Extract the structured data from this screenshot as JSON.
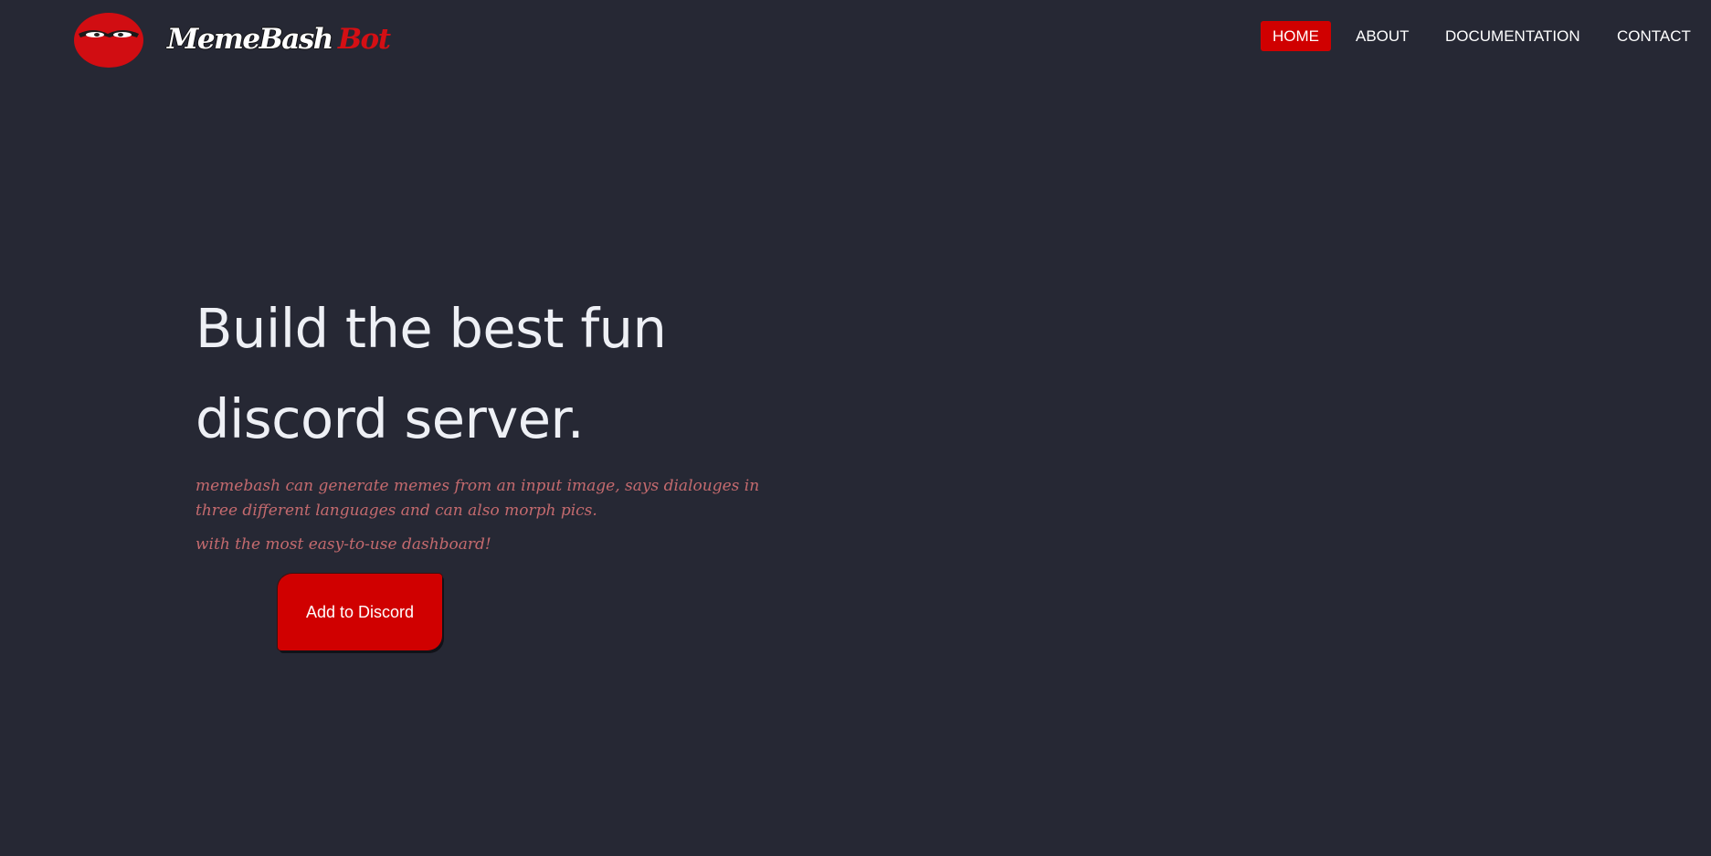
{
  "header": {
    "brand_part1": "MemeBash",
    "brand_part2": "Bot",
    "logo_icon": "masked-face-logo-icon"
  },
  "nav": {
    "items": [
      {
        "label": "HOME",
        "active": true
      },
      {
        "label": "ABOUT",
        "active": false
      },
      {
        "label": "DOCUMENTATION",
        "active": false
      },
      {
        "label": "CONTACT",
        "active": false
      }
    ]
  },
  "hero": {
    "title_line1": "Build the best fun",
    "title_line2": "discord server.",
    "description": "memebash can generate memes from an input image, says dialouges in three different languages and can also morph pics.",
    "tagline": "with the most easy-to-use dashboard!",
    "cta_label": "Add to Discord"
  },
  "colors": {
    "background": "#262834",
    "accent": "#d00000",
    "text": "#eef0f5",
    "subtext": "#c46a6e"
  }
}
